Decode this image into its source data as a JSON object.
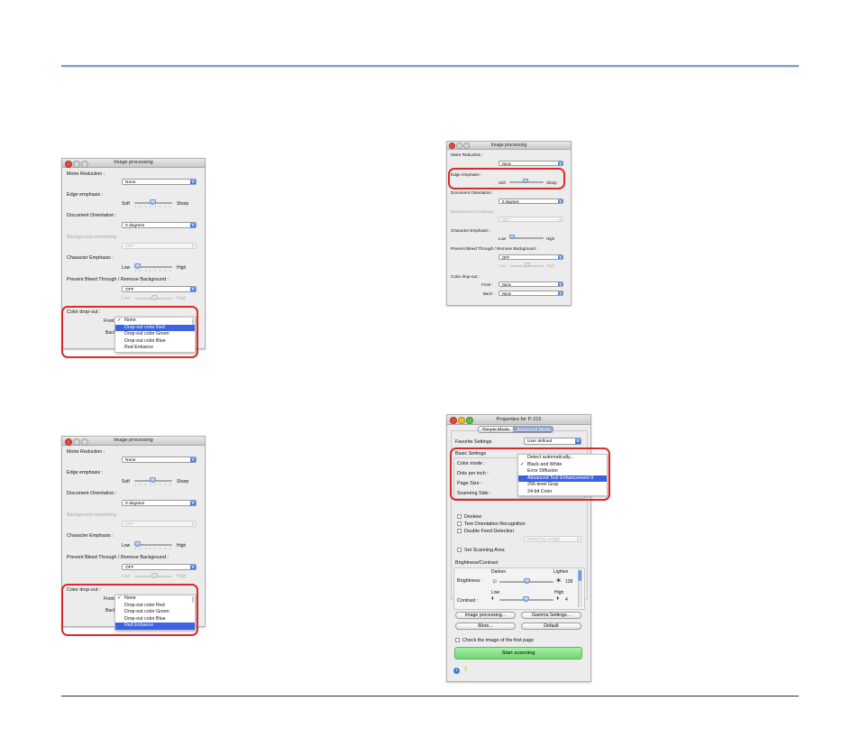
{
  "ip_window": {
    "title": "Image processing",
    "moire_label": "Moire Reduction :",
    "moire_value": "None",
    "edge_label": "Edge emphasis :",
    "soft": "Soft",
    "sharp": "Sharp",
    "orientation_label": "Document Orientation :",
    "orientation_value": "0 degrees",
    "bg_smoothing_label": "Background smoothing :",
    "bg_smoothing_value": "OFF",
    "char_emphasis_label": "Character Emphasis :",
    "low": "Low",
    "high": "High",
    "bleed_label": "Prevent Bleed Through / Remove Background :",
    "bleed_value": "OFF",
    "dropout_label": "Color drop-out :",
    "front": "Front :",
    "back": "Back :",
    "dropout_value": "None"
  },
  "dropout_menu": {
    "items": [
      "None",
      "Drop-out color Red",
      "Drop-out color Green",
      "Drop-out color Blue",
      "Red Enhance"
    ],
    "checkmark": "✓"
  },
  "props_window": {
    "title": "Properties for P-215",
    "tabs": [
      "Simple Mode",
      "Advanced Mode"
    ],
    "favorite_label": "Favorite Settings",
    "favorite_value": "User defined",
    "basic_settings": "Basic Settings",
    "color_mode": "Color mode :",
    "dpi": "Dots per inch :",
    "page_size": "Page Size :",
    "scanning_side": "Scanning Side :",
    "color_menu": [
      "Detect automatically...",
      "Black and White",
      "Error Diffusion",
      "Advanced Text Enhancement II",
      "256-level Gray",
      "24-bit Color"
    ],
    "deskew": "Deskew",
    "text_orientation": "Text Orientation Recognition",
    "double_feed": "Double Feed Detection",
    "detect_by_length": "Detect by Length",
    "set_scanning_area": "Set Scanning Area",
    "brightness_contrast": "Brightness/Contrast",
    "brightness": "Brightness :",
    "darken": "Darken",
    "lighten": "Lighten",
    "brightness_value": "128",
    "contrast": "Contrast :",
    "low": "Low",
    "high": "High",
    "contrast_value": "4",
    "image_processing_btn": "Image processing...",
    "gamma_btn": "Gamma Settings...",
    "more_btn": "More...",
    "default_btn": "Default",
    "check_first_page": "Check the image of the first page",
    "start_scanning": "Start scanning"
  },
  "colors": {
    "highlight_red": "#d92b2b",
    "menu_blue": "#3b62e0",
    "rule_blue": "#7a9fd1",
    "start_green": "#7de07d"
  }
}
